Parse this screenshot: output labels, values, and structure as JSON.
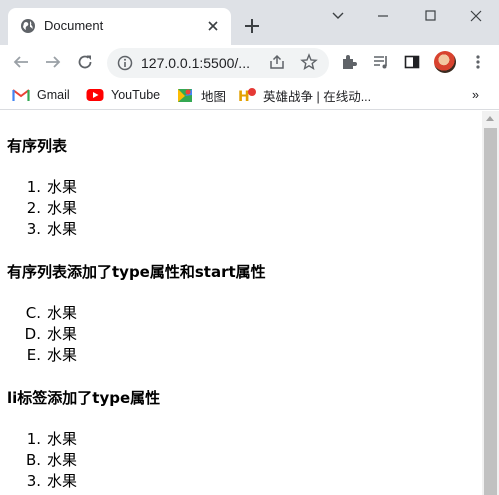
{
  "browser": {
    "tab_title": "Document",
    "url": "127.0.0.1:5500/...",
    "bookmarks": [
      {
        "label": "Gmail",
        "icon": "gmail-icon"
      },
      {
        "label": "YouTube",
        "icon": "youtube-icon"
      },
      {
        "label": "地图",
        "icon": "maps-icon"
      },
      {
        "label": "英雄战争 | 在线动...",
        "icon": "game-site-icon"
      }
    ],
    "more_bookmarks": "»"
  },
  "page": {
    "sections": [
      {
        "heading": "有序列表",
        "items": [
          {
            "marker": "1.",
            "text": "水果"
          },
          {
            "marker": "2.",
            "text": "水果"
          },
          {
            "marker": "3.",
            "text": "水果"
          }
        ]
      },
      {
        "heading": "有序列表添加了type属性和start属性",
        "items": [
          {
            "marker": "C.",
            "text": "水果"
          },
          {
            "marker": "D.",
            "text": "水果"
          },
          {
            "marker": "E.",
            "text": "水果"
          }
        ]
      },
      {
        "heading": "li标签添加了type属性",
        "items": [
          {
            "marker": "1.",
            "text": "水果"
          },
          {
            "marker": "B.",
            "text": "水果"
          },
          {
            "marker": "3.",
            "text": "水果"
          }
        ]
      }
    ]
  },
  "colors": {
    "titlebar": "#dee1e6",
    "omnibox": "#f1f3f4",
    "text": "#202124",
    "icon": "#5f6368"
  }
}
